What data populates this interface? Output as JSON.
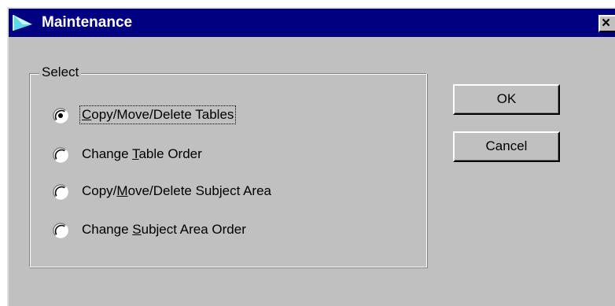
{
  "window": {
    "title": "Maintenance",
    "close_label": "×",
    "icon": "maintenance-app-icon"
  },
  "group": {
    "label": "Select"
  },
  "options": [
    {
      "pre": "",
      "accel": "C",
      "post": "opy/Move/Delete Tables",
      "selected": true,
      "focused": true
    },
    {
      "pre": "Change ",
      "accel": "T",
      "post": "able Order",
      "selected": false,
      "focused": false
    },
    {
      "pre": "Copy/",
      "accel": "M",
      "post": "ove/Delete Subject Area",
      "selected": false,
      "focused": false
    },
    {
      "pre": "Change ",
      "accel": "S",
      "post": "ubject Area Order",
      "selected": false,
      "focused": false
    }
  ],
  "buttons": {
    "ok_label": "OK",
    "cancel_label": "Cancel"
  },
  "colors": {
    "titlebar": "#000080",
    "face": "#c0c0c0"
  }
}
